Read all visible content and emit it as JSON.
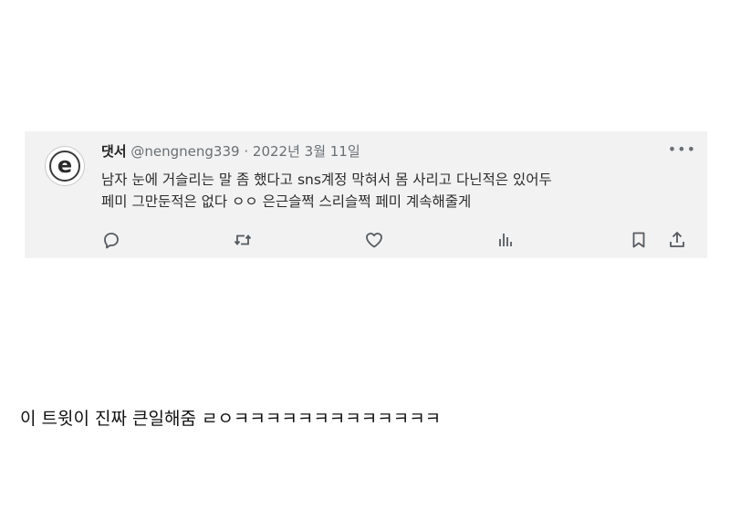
{
  "tweet": {
    "display_name": "댓서",
    "handle": "@nengneng339",
    "separator": "·",
    "date": "2022년 3월 11일",
    "avatar_letter": "e",
    "more_label": "•••",
    "lines": [
      "남자 눈에 거슬리는 말 좀 했다고 sns계정 막혀서 몸 사리고 다닌적은 있어두",
      "페미 그만둔적은 없다 ㅇㅇ 은근슬쩍 스리슬쩍 페미 계속해줄게"
    ],
    "actions": [
      "reply-icon",
      "retweet-icon",
      "like-icon",
      "views-icon",
      "bookmark-icon",
      "share-icon"
    ]
  },
  "caption": "이 트윗이 진짜 큰일해줌 ㄹㅇㅋㅋㅋㅋㅋㅋㅋㅋㅋㅋㅋㅋㅋ",
  "colors": {
    "card_background": "#f2f2f2",
    "secondary_text": "#6a6f74",
    "primary_text": "#2b2b2b"
  }
}
